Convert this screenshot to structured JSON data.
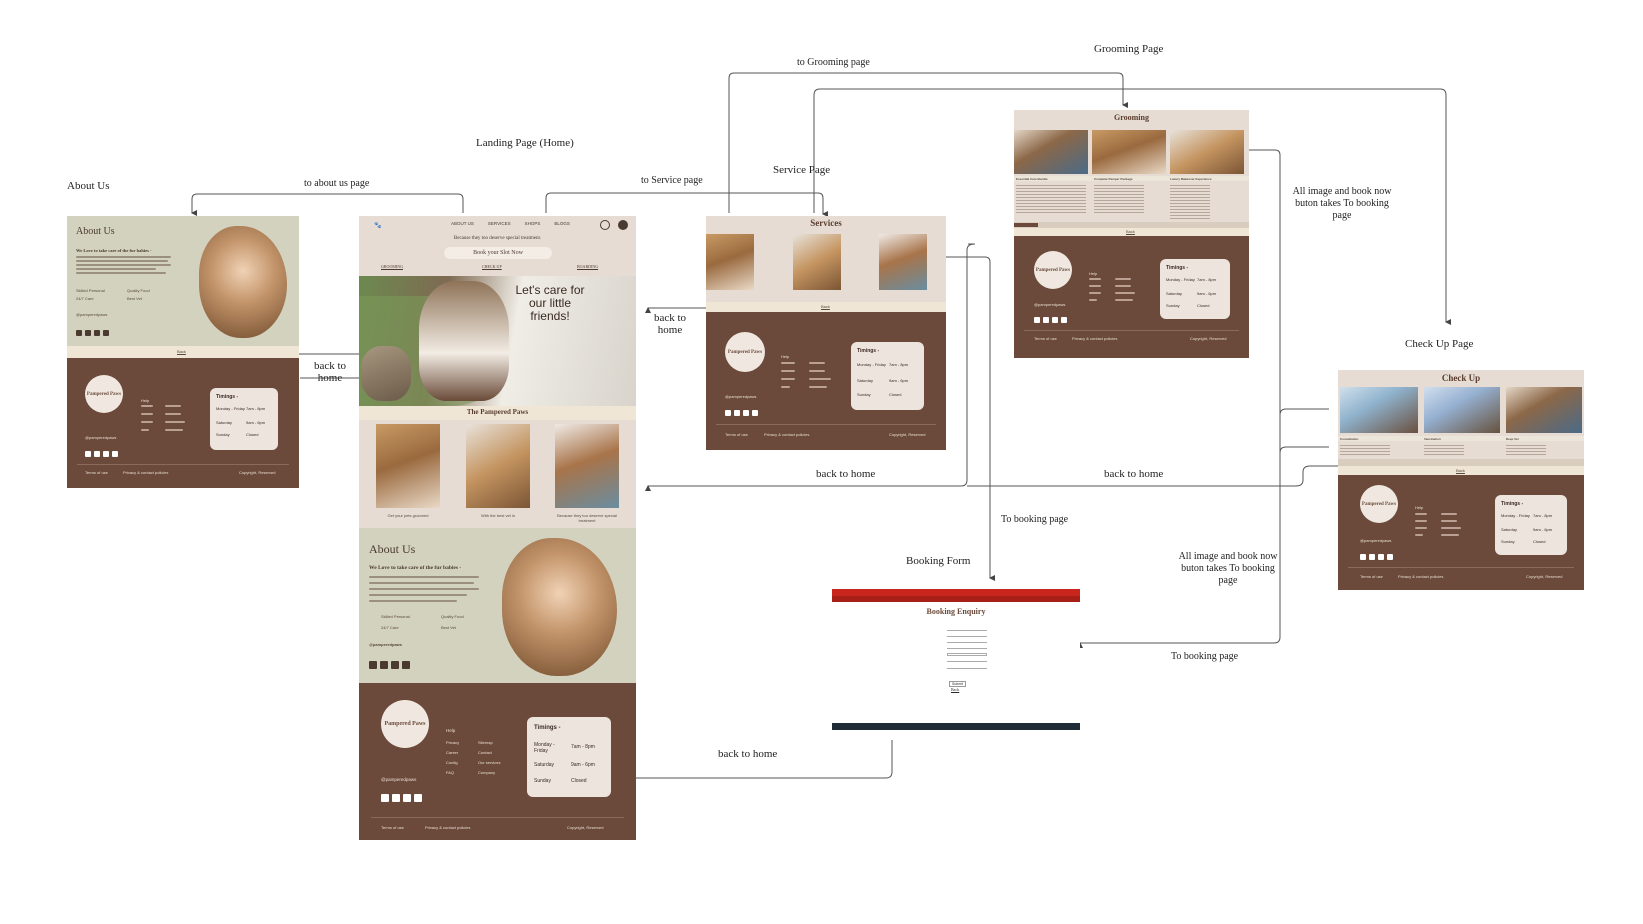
{
  "labels": {
    "grooming_page": "Grooming Page",
    "to_grooming": "to Grooming page",
    "landing": "Landing Page (Home)",
    "service_page": "Service Page",
    "about_us": "About Us",
    "to_about": "to about us page",
    "to_service": "to Service page",
    "check_up_page": "Check Up Page",
    "back_to_home_left": "back to home",
    "back_to_home_mid": "back to home",
    "back_to_home_service": "back to home",
    "back_to_home_checkup": "back to home",
    "back_to_home_bottom": "back to home",
    "to_booking_1": "To booking page",
    "to_booking_2": "To booking page",
    "booking_form": "Booking Form",
    "grooming_note": "All image and book now buton takes To booking page",
    "checkup_note": "All image and book now buton takes To booking page"
  },
  "about": {
    "title": "About Us",
    "subtitle": "We Love to take care of the fur babies -",
    "feat1": "Skilled Personal",
    "feat2": "Quality Food",
    "feat3": "24/7 Care",
    "feat4": "Best Vet",
    "handle": "@pamperedpaws",
    "back": "Back"
  },
  "footer": {
    "logo": "Pampered Paws",
    "help": "Help",
    "col1": [
      "Privacy",
      "Career",
      "Config",
      "FAQ"
    ],
    "col2": [
      "Sitemap",
      "Contact",
      "Our services",
      "Company"
    ],
    "timings_title": "Timings -",
    "row1_day": "Monday - Friday",
    "row1_time": "7am - 8pm",
    "row2_day": "Saturday",
    "row2_time": "9am - 6pm",
    "row3_day": "Sunday",
    "row3_time": "Closed",
    "handle": "@pamperedpaws",
    "terms": "Terms of use",
    "privacy": "Privacy & contact policies",
    "copyright": "Copyright, Reserved"
  },
  "home": {
    "nav": [
      "ABOUT US",
      "SERVICES",
      "SHOPS",
      "BLOGS"
    ],
    "tagline": "Because they too deserve special treatment.",
    "book_btn": "Book your Slot Now",
    "links": [
      "GROOMING",
      "CHECK UP",
      "BOARDING"
    ],
    "hero_text": "Let's care for our little friends!",
    "section_title": "The Pampered Paws",
    "card1": "Get your pets groomed",
    "card2": "With the best vet in",
    "card3": "Because they too deserve special treatment"
  },
  "services": {
    "title": "Services",
    "back": "Back"
  },
  "grooming": {
    "title": "Grooming",
    "col1": "Essential Care Bundle",
    "col2": "Complete Pamper Package",
    "col3": "Luxury Makeover Experience",
    "back": "Back"
  },
  "checkup": {
    "title": "Check Up",
    "col1": "Consultation",
    "col2": "Vaccination",
    "col3": "Deep Vet",
    "back": "Back"
  },
  "booking": {
    "title": "Booking Enquiry",
    "submit": "Submit",
    "back": "Back"
  }
}
